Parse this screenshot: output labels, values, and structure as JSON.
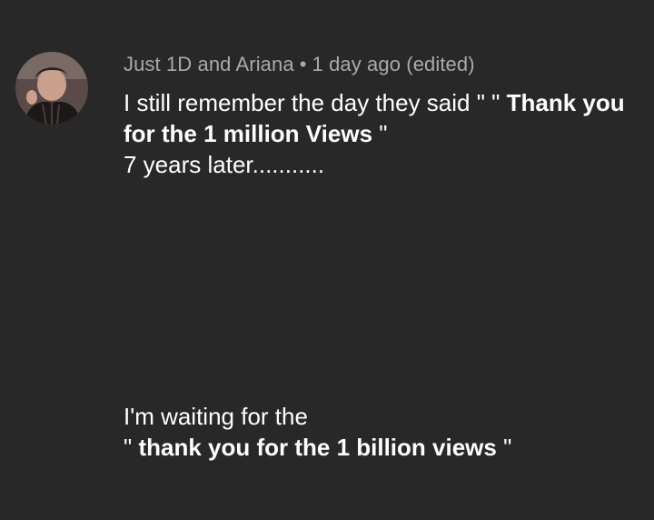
{
  "comment": {
    "author": "Just 1D and Ariana",
    "separator": "•",
    "timestamp": "1 day ago (edited)",
    "avatar_icon": "user-avatar-icon",
    "line1_regular": "I still remember the day they said \" \" ",
    "line1_bold": "Thank you for the 1 million Views ",
    "line1_end": "\"",
    "line2": "7 years later...........",
    "line3": "I'm waiting for the",
    "line4_start": "\" ",
    "line4_bold": "thank you for the 1 billion views ",
    "line4_end": "\""
  },
  "colors": {
    "background": "#282828",
    "meta_text": "#aaaaaa",
    "body_text": "#ffffff"
  }
}
